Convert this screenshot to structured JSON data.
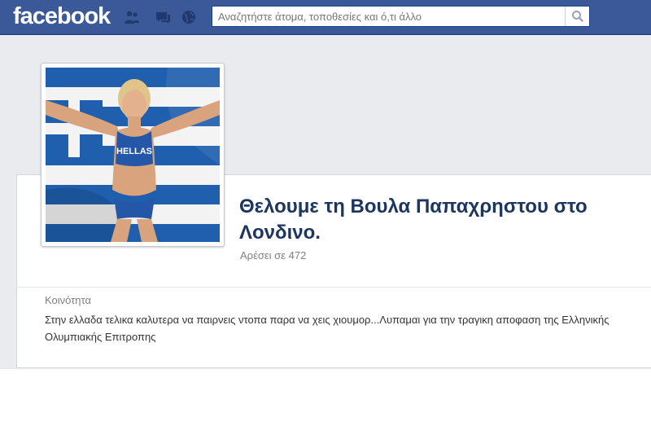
{
  "header": {
    "logo": "facebook",
    "search": {
      "placeholder": "Αναζητήστε άτομα, τοποθεσίες και ό,τι άλλο"
    },
    "jewels": [
      "friend-requests-icon",
      "messages-icon",
      "notifications-icon"
    ]
  },
  "page": {
    "title": "Θελουμε τη Βουλα Παπαχρηστου στο Λονδινο.",
    "likes": "Αρέσει σε 472",
    "profile_photo": {
      "shirt_text": "HELLAS"
    },
    "about": {
      "label": "Κοινότητα",
      "text": "Στην ελλαδα τελικα καλυτερα να παιρνεις ντοπα παρα να χεις χιουμορ...Λυπαμαι για την τραγικη αποφαση της Ελληνικής Ολυμπιακής Επιτροπης"
    }
  },
  "colors": {
    "topbar": "#3b5998",
    "title": "#1d3660",
    "flag_blue": "#0d5eaf"
  }
}
